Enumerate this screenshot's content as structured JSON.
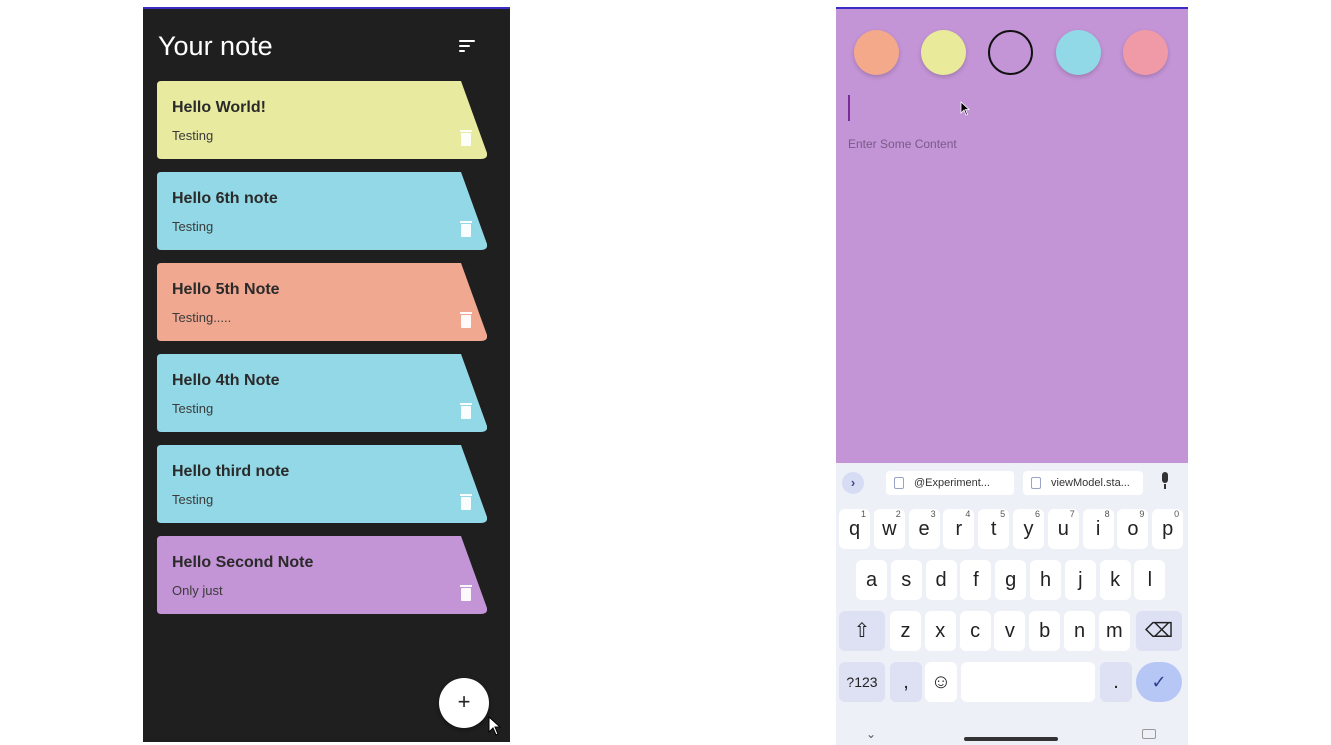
{
  "notes_screen": {
    "title": "Your note",
    "notes": [
      {
        "title": "Hello World!",
        "content": "Testing",
        "color": "#e8eaa0"
      },
      {
        "title": "Hello 6th note",
        "content": "Testing",
        "color": "#92d8e6"
      },
      {
        "title": "Hello 5th Note",
        "content": "Testing.....",
        "color": "#f0a890"
      },
      {
        "title": "Hello 4th Note",
        "content": "Testing",
        "color": "#92d8e6"
      },
      {
        "title": "Hello third note",
        "content": "Testing",
        "color": "#92d8e6"
      },
      {
        "title": "Hello Second Note",
        "content": "Only just",
        "color": "#c394d6"
      }
    ],
    "fab_label": "+"
  },
  "editor_screen": {
    "background": "#c394d6",
    "colors": [
      "#f4a98a",
      "#e9eb9a",
      "#c394d6",
      "#92d9e8",
      "#f09aa8"
    ],
    "title_value": "",
    "content_placeholder": "Enter Some Content",
    "keyboard": {
      "suggestions": [
        "@Experiment...",
        "viewModel.sta..."
      ],
      "row1": [
        {
          "k": "q",
          "h": "1"
        },
        {
          "k": "w",
          "h": "2"
        },
        {
          "k": "e",
          "h": "3"
        },
        {
          "k": "r",
          "h": "4"
        },
        {
          "k": "t",
          "h": "5"
        },
        {
          "k": "y",
          "h": "6"
        },
        {
          "k": "u",
          "h": "7"
        },
        {
          "k": "i",
          "h": "8"
        },
        {
          "k": "o",
          "h": "9"
        },
        {
          "k": "p",
          "h": "0"
        }
      ],
      "row2": [
        "a",
        "s",
        "d",
        "f",
        "g",
        "h",
        "j",
        "k",
        "l"
      ],
      "row3": [
        "z",
        "x",
        "c",
        "v",
        "b",
        "n",
        "m"
      ],
      "symbols_label": "?123",
      "comma_label": ",",
      "emoji_label": "☺",
      "period_label": ".",
      "shift_label": "⇧",
      "backspace_label": "⌫",
      "enter_label": "✓",
      "expand_label": "›"
    }
  }
}
